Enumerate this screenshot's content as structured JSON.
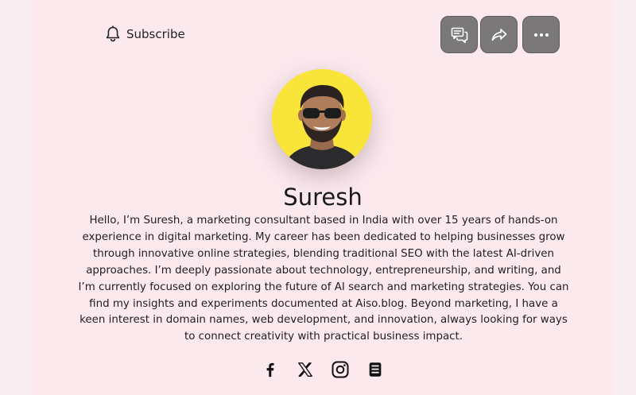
{
  "header": {
    "subscribe_label": "Subscribe",
    "actions": [
      {
        "icon": "chat-icon"
      },
      {
        "icon": "share-icon"
      },
      {
        "icon": "more-icon"
      }
    ]
  },
  "profile": {
    "name": "Suresh",
    "bio": "Hello, I’m Suresh, a marketing consultant based in India with over 15 years of hands-on experience in digital marketing. My career has been dedicated to helping businesses grow through innovative online strategies, blending traditional SEO with the latest AI-driven approaches. I’m deeply passionate about technology, entrepreneurship, and writing, and I’m currently focused on exploring the future of AI search and marketing strategies. You can find my insights and experiments documented at Aiso.blog. Beyond marketing, I have a keen interest in domain names, web development, and innovation, always looking for ways to connect creativity with practical business impact."
  },
  "socials": [
    {
      "icon": "facebook-icon"
    },
    {
      "icon": "x-twitter-icon"
    },
    {
      "icon": "instagram-icon"
    },
    {
      "icon": "blog-icon"
    }
  ],
  "colors": {
    "background": "#fbe9ee",
    "button": "#7b7879",
    "avatar_bg": "#f9e53a"
  }
}
